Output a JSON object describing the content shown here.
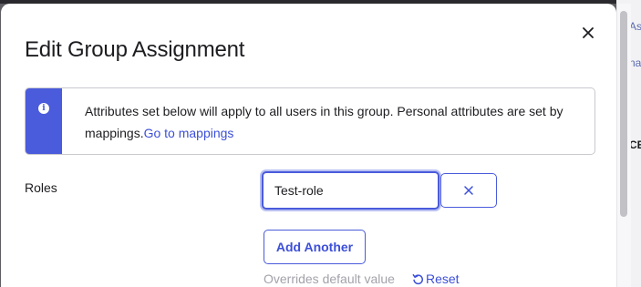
{
  "background": {
    "right_texts": [
      "As",
      "na",
      "CE"
    ]
  },
  "modal": {
    "title": "Edit Group Assignment",
    "close_icon": "close-icon"
  },
  "callout": {
    "icon": "info-icon",
    "text": "Attributes set below will apply to all users in this group. Personal attributes are set by mappings.",
    "link_text": "Go to mappings"
  },
  "roles": {
    "label": "Roles",
    "value": "Test-role",
    "remove_icon": "close-icon",
    "add_button_label": "Add Another",
    "overrides_text": "Overrides default value",
    "reset_label": "Reset",
    "reset_icon": "reset-icon"
  },
  "colors": {
    "accent": "#4a5bdb",
    "link": "#3c4fd8",
    "text": "#1d1d21",
    "muted": "#a2a2aa"
  }
}
